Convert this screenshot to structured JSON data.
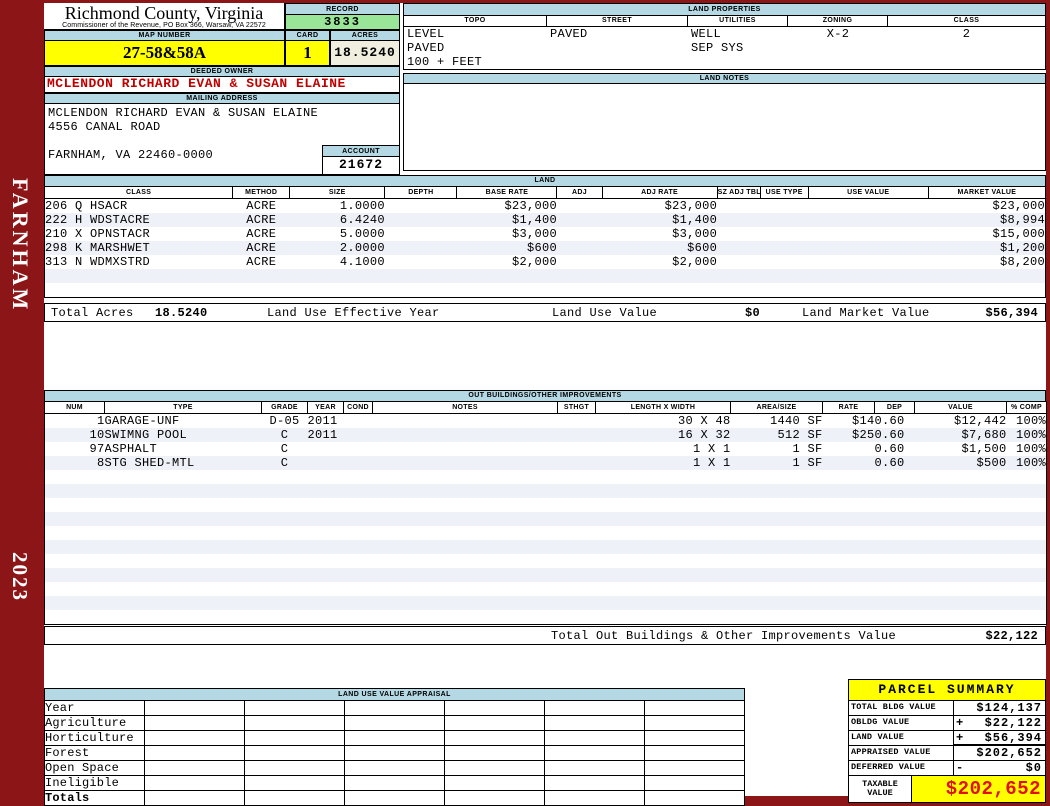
{
  "sidebar": {
    "district": "FARNHAM",
    "year": "2023"
  },
  "header": {
    "county": "Richmond County, Virginia",
    "commissioner": "Commissioner of the Revenue, PO Box 366, Warsaw, VA 22572",
    "record_label": "RECORD",
    "record_value": "3833",
    "map_number_label": "MAP NUMBER",
    "map_number_value": "27-58&58A",
    "card_label": "CARD",
    "card_value": "1",
    "acres_label": "ACRES",
    "acres_value": "18.5240",
    "deeded_owner_label": "DEEDED OWNER",
    "deeded_owner_value": "MCLENDON RICHARD EVAN & SUSAN ELAINE",
    "mailing_address_label": "MAILING ADDRESS",
    "mailing_address_lines": [
      "MCLENDON RICHARD EVAN & SUSAN ELAINE",
      "4556 CANAL ROAD",
      "",
      "FARNHAM, VA 22460-0000"
    ],
    "account_label": "ACCOUNT",
    "account_value": "21672"
  },
  "land_properties": {
    "title": "LAND PROPERTIES",
    "columns": [
      "TOPO",
      "STREET",
      "UTILITIES",
      "ZONING",
      "CLASS"
    ],
    "values": [
      [
        "LEVEL",
        "PAVED",
        "100 + FEET"
      ],
      [
        "PAVED"
      ],
      [
        "WELL",
        "SEP SYS"
      ],
      [
        "X-2"
      ],
      [
        "2"
      ]
    ]
  },
  "land_notes": {
    "title": "LAND NOTES",
    "text": ""
  },
  "land": {
    "title": "LAND",
    "columns": [
      "CLASS",
      "METHOD",
      "SIZE",
      "DEPTH",
      "BASE RATE",
      "ADJ",
      "ADJ RATE",
      "SZ ADJ TBL",
      "USE TYPE",
      "USE VALUE",
      "MARKET VALUE"
    ],
    "rows": [
      {
        "class": "206 Q HSACR",
        "method": "ACRE",
        "size": "1.0000",
        "depth": "",
        "base_rate": "$23,000",
        "adj": "",
        "adj_rate": "$23,000",
        "sz_adj_tbl": "",
        "use_type": "",
        "use_value": "",
        "market_value": "$23,000"
      },
      {
        "class": "222 H WDSTACRE",
        "method": "ACRE",
        "size": "6.4240",
        "depth": "",
        "base_rate": "$1,400",
        "adj": "",
        "adj_rate": "$1,400",
        "sz_adj_tbl": "",
        "use_type": "",
        "use_value": "",
        "market_value": "$8,994"
      },
      {
        "class": "210 X OPNSTACR",
        "method": "ACRE",
        "size": "5.0000",
        "depth": "",
        "base_rate": "$3,000",
        "adj": "",
        "adj_rate": "$3,000",
        "sz_adj_tbl": "",
        "use_type": "",
        "use_value": "",
        "market_value": "$15,000"
      },
      {
        "class": "298 K MARSHWET",
        "method": "ACRE",
        "size": "2.0000",
        "depth": "",
        "base_rate": "$600",
        "adj": "",
        "adj_rate": "$600",
        "sz_adj_tbl": "",
        "use_type": "",
        "use_value": "",
        "market_value": "$1,200"
      },
      {
        "class": "313 N WDMXSTRD",
        "method": "ACRE",
        "size": "4.1000",
        "depth": "",
        "base_rate": "$2,000",
        "adj": "",
        "adj_rate": "$2,000",
        "sz_adj_tbl": "",
        "use_type": "",
        "use_value": "",
        "market_value": "$8,200"
      }
    ],
    "total_acres_label": "Total Acres",
    "total_acres_value": "18.5240",
    "effective_year_label": "Land Use Effective Year",
    "land_use_value_label": "Land Use Value",
    "land_use_value": "$0",
    "land_market_value_label": "Land Market Value",
    "land_market_value": "$56,394"
  },
  "out_buildings": {
    "title": "OUT BUILDINGS/OTHER IMPROVEMENTS",
    "columns": [
      "NUM",
      "TYPE",
      "GRADE",
      "YEAR",
      "COND",
      "NOTES",
      "STHGT",
      "LENGTH X WIDTH",
      "AREA/SIZE",
      "RATE",
      "DEP",
      "VALUE",
      "% COMP"
    ],
    "rows": [
      {
        "num": "1",
        "type": "GARAGE-UNF",
        "grade": "D-05",
        "year": "2011",
        "cond": "",
        "notes": "",
        "sthgt": "",
        "lxw": "30 X 48",
        "area": "1440 SF",
        "rate": "$14",
        "dep": "0.60",
        "value": "$12,442",
        "comp": "100%"
      },
      {
        "num": "10",
        "type": "SWIMNG POOL",
        "grade": "C",
        "year": "2011",
        "cond": "",
        "notes": "",
        "sthgt": "",
        "lxw": "16 X 32",
        "area": "512 SF",
        "rate": "$25",
        "dep": "0.60",
        "value": "$7,680",
        "comp": "100%"
      },
      {
        "num": "97",
        "type": "ASPHALT",
        "grade": "C",
        "year": "",
        "cond": "",
        "notes": "",
        "sthgt": "",
        "lxw": "1 X 1",
        "area": "1 SF",
        "rate": "",
        "dep": "0.60",
        "value": "$1,500",
        "comp": "100%"
      },
      {
        "num": "8",
        "type": "STG SHED-MTL",
        "grade": "C",
        "year": "",
        "cond": "",
        "notes": "",
        "sthgt": "",
        "lxw": "1 X 1",
        "area": "1 SF",
        "rate": "",
        "dep": "0.60",
        "value": "$500",
        "comp": "100%"
      }
    ],
    "total_label": "Total Out Buildings & Other Improvements Value",
    "total_value": "$22,122"
  },
  "land_use_appraisal": {
    "title": "LAND USE VALUE APPRAISAL",
    "row_labels": [
      "Year",
      "Agriculture",
      "Horticulture",
      "Forest",
      "Open Space",
      "Ineligible",
      "Totals"
    ],
    "num_columns": 6
  },
  "parcel_summary": {
    "title": "PARCEL SUMMARY",
    "rows": [
      {
        "label": "TOTAL BLDG VALUE",
        "op": "",
        "value": "$124,137"
      },
      {
        "label": "OBLDG VALUE",
        "op": "+",
        "value": "$22,122"
      },
      {
        "label": "LAND VALUE",
        "op": "+",
        "value": "$56,394"
      },
      {
        "label": "APPRAISED VALUE",
        "op": "",
        "value": "$202,652"
      },
      {
        "label": "DEFERRED VALUE",
        "op": "-",
        "value": "$0"
      }
    ],
    "taxable_label": "TAXABLE VALUE",
    "taxable_value": "$202,652"
  },
  "colors": {
    "frame_maroon": "#8C1518",
    "header_blue": "#B4D8E4",
    "record_green": "#99E699",
    "highlight_yellow": "#FFFF00",
    "acres_beige": "#EFEEDF",
    "owner_red": "#C00000",
    "taxable_red": "#E01010",
    "row_stripe": "#EFF1F9"
  }
}
